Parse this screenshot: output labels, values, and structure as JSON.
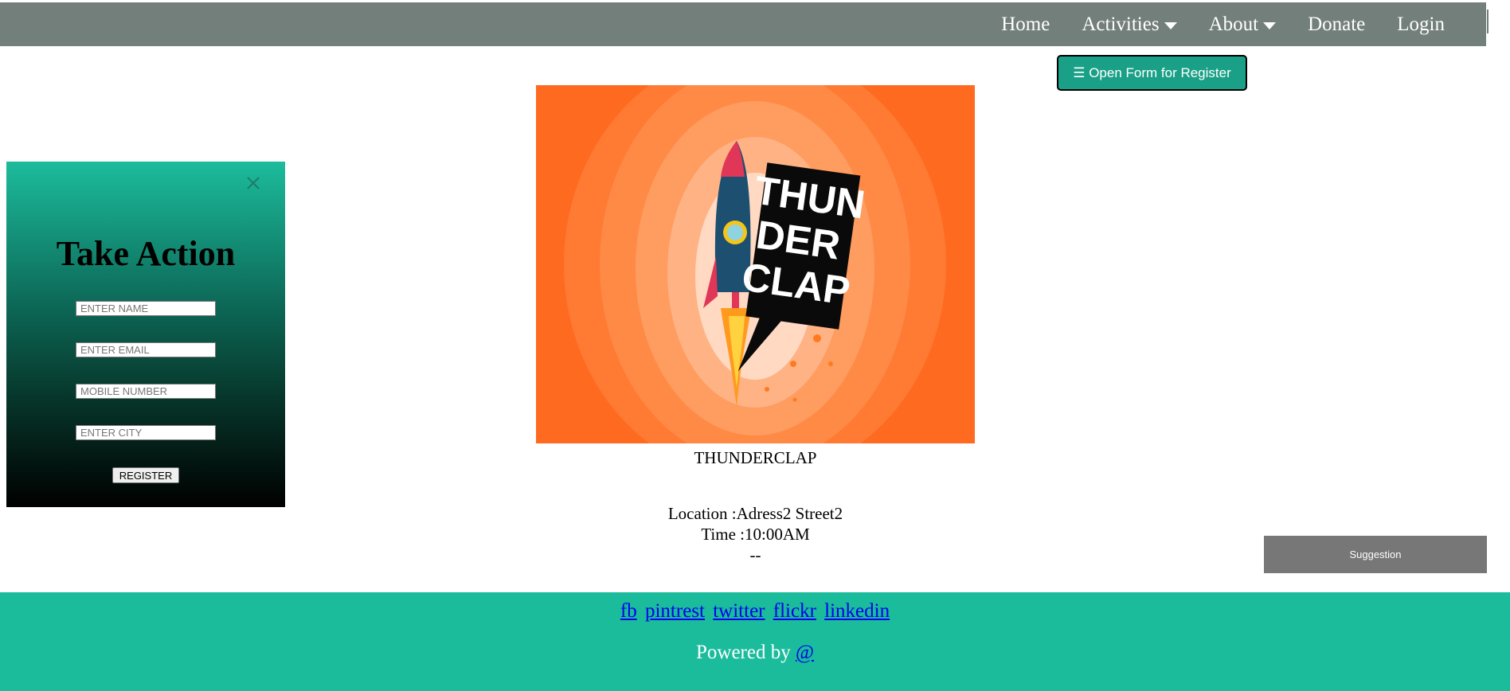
{
  "nav": {
    "items": [
      {
        "label": "Home",
        "dropdown": false
      },
      {
        "label": "Activities",
        "dropdown": true
      },
      {
        "label": "About",
        "dropdown": true
      },
      {
        "label": "Donate",
        "dropdown": false
      },
      {
        "label": "Login",
        "dropdown": false
      }
    ]
  },
  "open_form_button": {
    "label": "☰ Open Form for Register"
  },
  "side_panel": {
    "title": "Take Action",
    "name_placeholder": "ENTER NAME",
    "email_placeholder": "ENTER EMAIL",
    "mobile_placeholder": "MOBILE NUMBER",
    "city_placeholder": "ENTER CITY",
    "register_label": "REGISTER"
  },
  "event": {
    "image_text": [
      "THUN",
      "DER",
      "CLAP"
    ],
    "name": "THUNDERCLAP",
    "location": "Location :Adress2 Street2",
    "time": "Time :10:00AM",
    "extra": "--"
  },
  "suggestion_button": {
    "label": "Suggestion"
  },
  "footer": {
    "links": [
      "fb",
      "pintrest",
      "twitter",
      "flickr",
      "linkedin"
    ],
    "powered_by": "Powered by",
    "powered_link": "@"
  },
  "colors": {
    "nav_bg": "#737f7b",
    "accent": "#1abc9c",
    "image_bg": "#ff6a21"
  }
}
